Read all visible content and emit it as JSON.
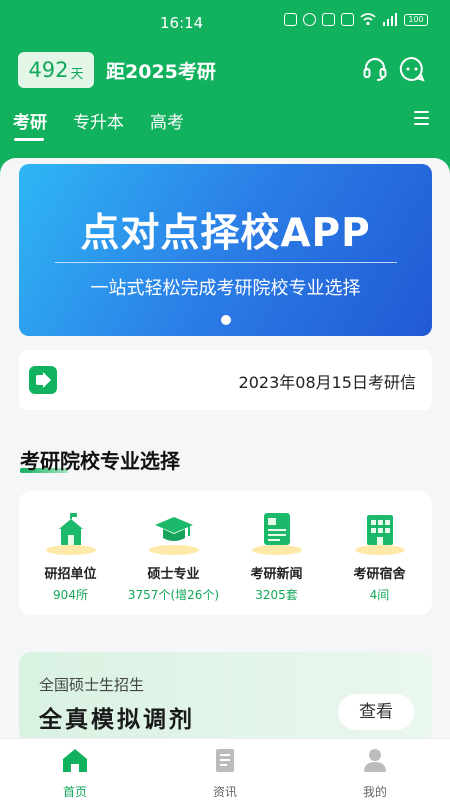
{
  "status_bar": {
    "time": "16:14",
    "battery": "100"
  },
  "header": {
    "days": "492",
    "days_unit": "天",
    "countdown_label": "距2025考研"
  },
  "tabs": [
    {
      "label": "考研",
      "active": true
    },
    {
      "label": "专升本",
      "active": false
    },
    {
      "label": "高考",
      "active": false
    }
  ],
  "banner": {
    "title": "点对点择校APP",
    "subtitle": "一站式轻松完成考研院校专业选择"
  },
  "notice": {
    "text": "2023年08月15日考研信"
  },
  "section": {
    "title": "考研院校专业选择"
  },
  "grid": [
    {
      "label": "研招单位",
      "count": "904所"
    },
    {
      "label": "硕士专业",
      "count": "3757个(增26个)"
    },
    {
      "label": "考研新闻",
      "count": "3205套"
    },
    {
      "label": "考研宿舍",
      "count": "4间"
    }
  ],
  "promo": {
    "subtitle": "全国硕士生招生",
    "title": "全真模拟调剂",
    "button": "查看"
  },
  "bottom_nav": [
    {
      "label": "首页",
      "active": true
    },
    {
      "label": "资讯",
      "active": false
    },
    {
      "label": "我的",
      "active": false
    }
  ],
  "colors": {
    "brand": "#12b15e",
    "text_count": "#12a859"
  }
}
